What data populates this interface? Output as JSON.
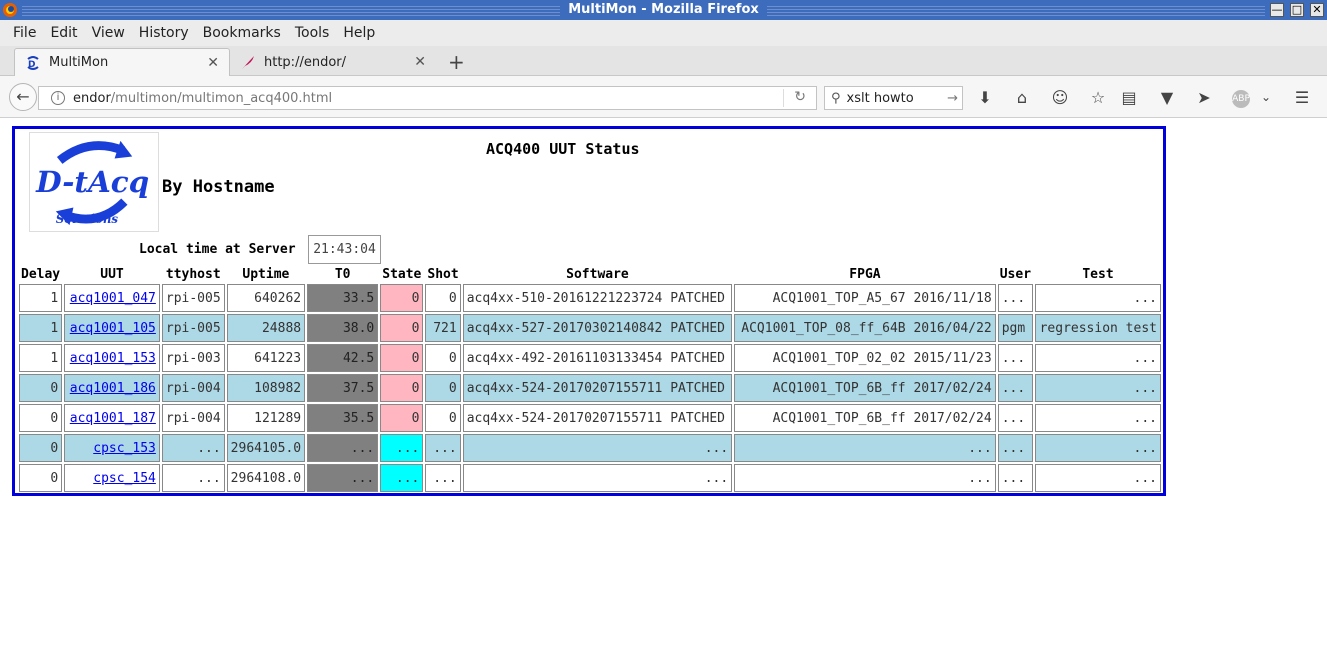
{
  "window": {
    "title": "MultiMon - Mozilla Firefox"
  },
  "menu": [
    "File",
    "Edit",
    "View",
    "History",
    "Bookmarks",
    "Tools",
    "Help"
  ],
  "tabs": [
    {
      "label": "MultiMon",
      "active": true
    },
    {
      "label": "http://endor/",
      "active": false
    }
  ],
  "nav": {
    "url_host": "endor",
    "url_path": "/multimon/multimon_acq400.html",
    "search_value": "xslt howto"
  },
  "page": {
    "title": "ACQ400 UUT Status",
    "subtitle": "By Hostname",
    "local_time_label": "Local time at Server",
    "local_time_value": "21:43:04",
    "columns": [
      "Delay",
      "UUT",
      "ttyhost",
      "Uptime",
      "T0",
      "State",
      "Shot",
      "Software",
      "FPGA",
      "User",
      "Test"
    ],
    "rows": [
      {
        "delay": "1",
        "uut": "acq1001_047",
        "ttyhost": "rpi-005",
        "uptime": "640262",
        "t0": "33.5",
        "state": "0",
        "shot": "0",
        "software": "acq4xx-510-20161221223724 PATCHED",
        "fpga": "ACQ1001_TOP_A5_67 2016/11/18",
        "user": "...",
        "test": "..."
      },
      {
        "delay": "1",
        "uut": "acq1001_105",
        "ttyhost": "rpi-005",
        "uptime": "24888",
        "t0": "38.0",
        "state": "0",
        "shot": "721",
        "software": "acq4xx-527-20170302140842 PATCHED",
        "fpga": "ACQ1001_TOP_08_ff_64B 2016/04/22",
        "user": "pgm",
        "test": "regression test"
      },
      {
        "delay": "1",
        "uut": "acq1001_153",
        "ttyhost": "rpi-003",
        "uptime": "641223",
        "t0": "42.5",
        "state": "0",
        "shot": "0",
        "software": "acq4xx-492-20161103133454 PATCHED",
        "fpga": "ACQ1001_TOP_02_02 2015/11/23",
        "user": "...",
        "test": "..."
      },
      {
        "delay": "0",
        "uut": "acq1001_186",
        "ttyhost": "rpi-004",
        "uptime": "108982",
        "t0": "37.5",
        "state": "0",
        "shot": "0",
        "software": "acq4xx-524-20170207155711 PATCHED",
        "fpga": "ACQ1001_TOP_6B_ff 2017/02/24",
        "user": "...",
        "test": "..."
      },
      {
        "delay": "0",
        "uut": "acq1001_187",
        "ttyhost": "rpi-004",
        "uptime": "121289",
        "t0": "35.5",
        "state": "0",
        "shot": "0",
        "software": "acq4xx-524-20170207155711 PATCHED",
        "fpga": "ACQ1001_TOP_6B_ff 2017/02/24",
        "user": "...",
        "test": "..."
      },
      {
        "delay": "0",
        "uut": "cpsc_153",
        "ttyhost": "...",
        "uptime": "2964105.0",
        "t0": "...",
        "state": "...",
        "shot": "...",
        "software": "...",
        "fpga": "...",
        "user": "...",
        "test": "..."
      },
      {
        "delay": "0",
        "uut": "cpsc_154",
        "ttyhost": "...",
        "uptime": "2964108.0",
        "t0": "...",
        "state": "...",
        "shot": "...",
        "software": "...",
        "fpga": "...",
        "user": "...",
        "test": "..."
      }
    ]
  },
  "colors": {
    "frame": "#0000dd",
    "row_highlight": "#add8e6",
    "t0_cell": "#808080",
    "state_pink": "#ffb6c1",
    "state_cyan": "#00ffff",
    "title_bar": "#3d6cbc"
  },
  "icons": [
    "firefox-icon",
    "minimize-icon",
    "maximize-icon",
    "close-icon",
    "multimon-tab-icon",
    "feather-tab-icon",
    "back-arrow-icon",
    "info-icon",
    "reload-icon",
    "search-icon",
    "go-arrow-icon",
    "downloads-icon",
    "home-icon",
    "chat-icon",
    "star-icon",
    "reader-icon",
    "pocket-icon",
    "send-icon",
    "adblock-icon",
    "menu-icon"
  ]
}
